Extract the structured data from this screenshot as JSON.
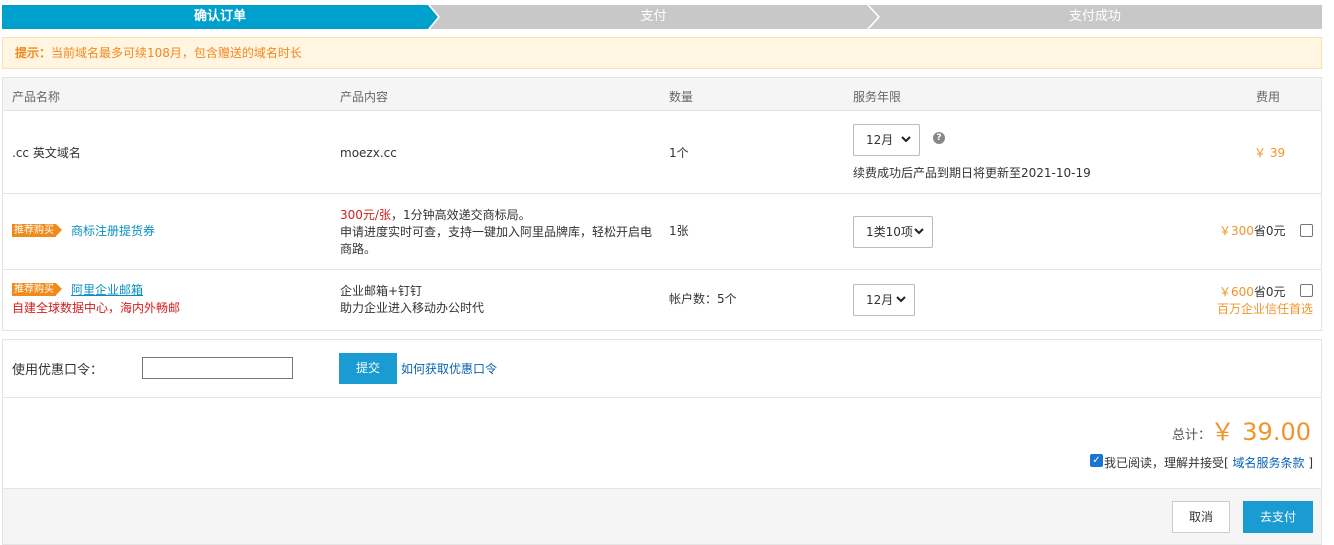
{
  "steps": [
    "确认订单",
    "支付",
    "支付成功"
  ],
  "colors": {
    "active_step": "#00a0cc",
    "inactive_step": "#c8c8c8",
    "price": "#f0952a",
    "accent": "#1a9bd2"
  },
  "notice": {
    "label": "提示：",
    "text": "当前域名最多可续108月，包含赠送的域名时长"
  },
  "table": {
    "headers": [
      "产品名称",
      "产品内容",
      "数量",
      "服务年限",
      "费用"
    ],
    "rows": [
      {
        "name": ".cc 英文域名",
        "content": "moezx.cc",
        "quantity": "1个",
        "period": "12月",
        "renew_note": "续费成功后产品到期日将更新至2021-10-19",
        "fee": "￥ 39"
      },
      {
        "tag": "推荐购买",
        "name": "商标注册提货券",
        "content_highlight": "300元/张",
        "content_rest": "，1分钟高效递交商标局。",
        "content_line2": "申请进度实时可查，支持一键加入阿里品牌库，轻松开启电",
        "content_line3": "商路。",
        "quantity": "1张",
        "period": "1类10项",
        "fee": "￥300",
        "saved": "省0元"
      },
      {
        "tag": "推荐购买",
        "name": "阿里企业邮箱",
        "subline": "自建全球数据中心，海内外畅邮",
        "content": "企业邮箱+钉钉",
        "content_line2": "助力企业进入移动办公时代",
        "quantity": "帐户数：5个",
        "period": "12月",
        "fee": "￥600",
        "saved": "省0元",
        "fee_note": "百万企业信任首选"
      }
    ]
  },
  "coupon": {
    "label": "使用优惠口令：",
    "input_value": "",
    "submit": "提交",
    "how_link": "如何获取优惠口令"
  },
  "total": {
    "label": "总计：",
    "value": "￥ 39.00"
  },
  "agreement": {
    "checked": true,
    "text": "我已阅读，理解并接受[",
    "link": "域名服务条款",
    "close": "]"
  },
  "actions": {
    "cancel": "取消",
    "pay": "去支付"
  }
}
